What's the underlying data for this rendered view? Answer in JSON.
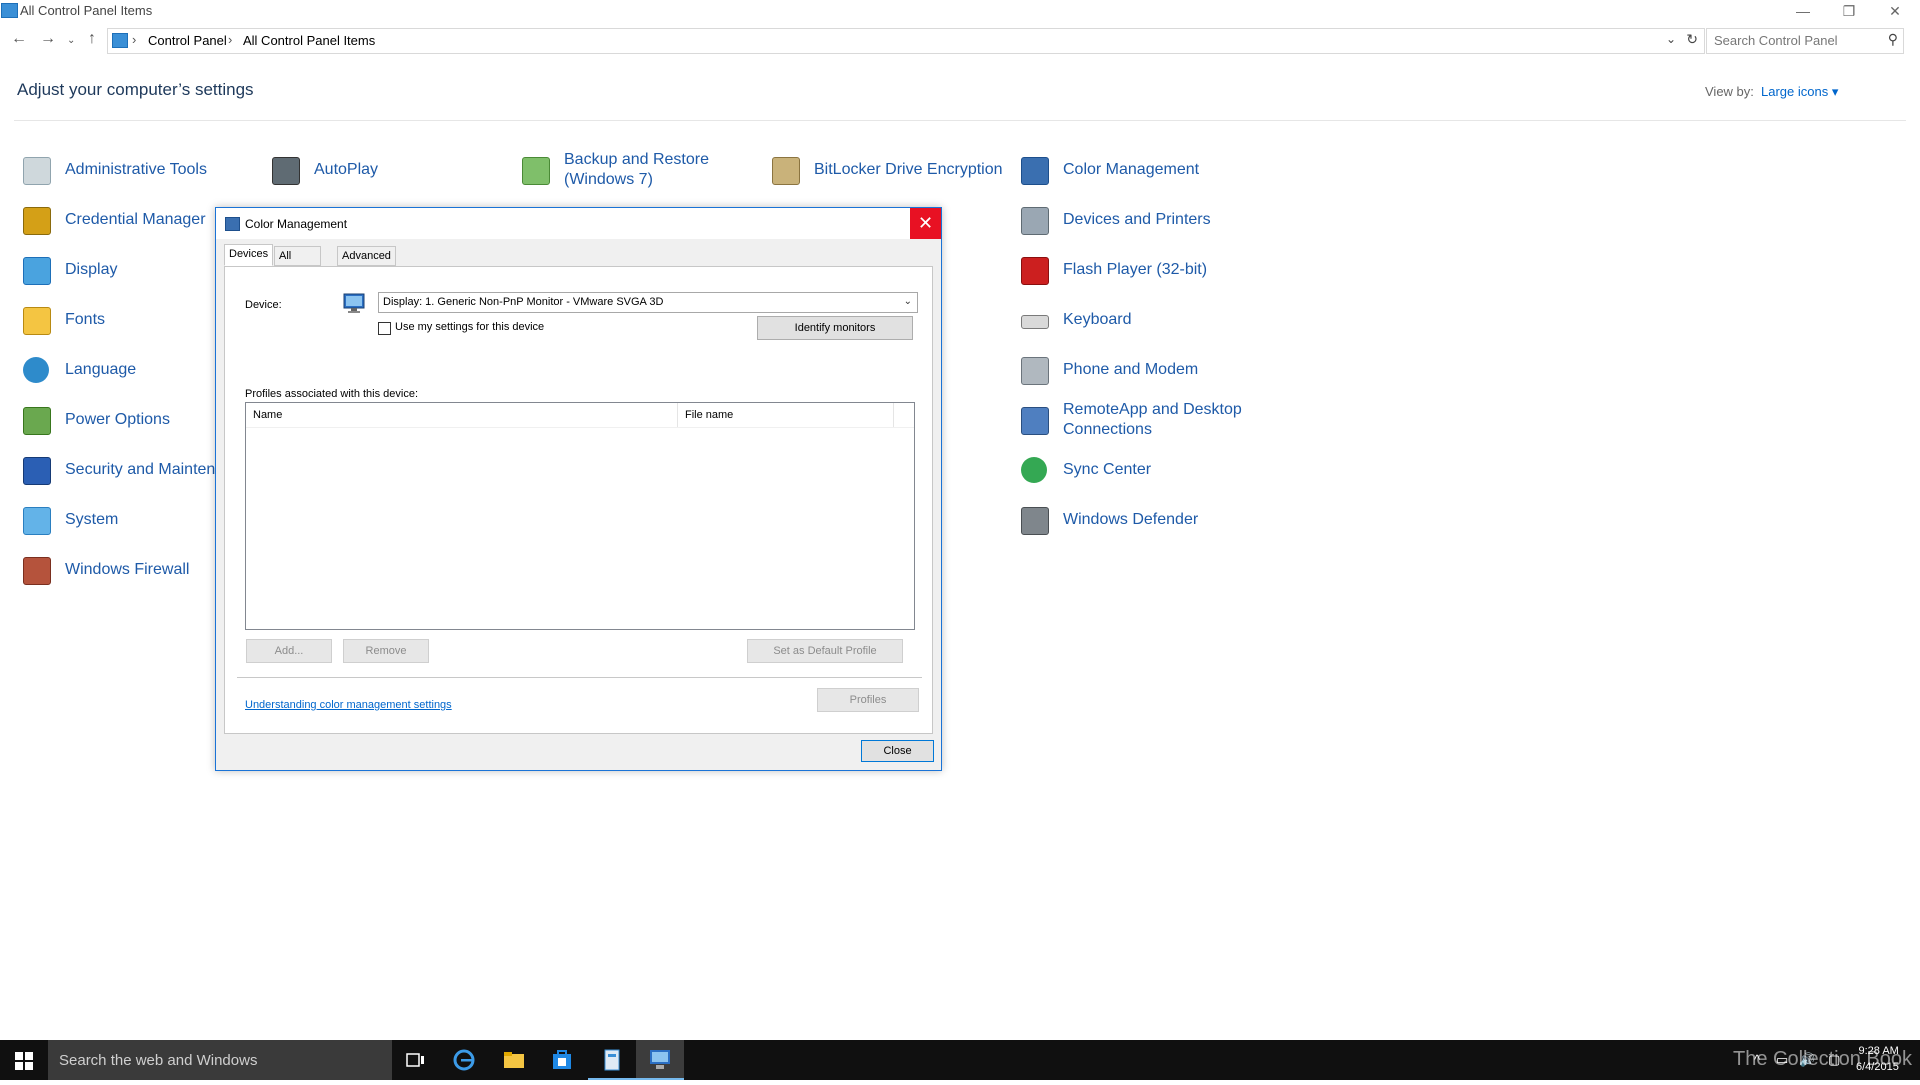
{
  "window": {
    "title": "All Control Panel Items",
    "minimize": "—",
    "maximize": "❐",
    "close": "✕"
  },
  "nav": {
    "back": "←",
    "forward": "→",
    "recent": "⌄",
    "up": "↑",
    "breadcrumb": [
      "Control Panel",
      "All Control Panel Items"
    ],
    "separator": "›",
    "dropdown": "⌄",
    "refresh": "↻",
    "search_placeholder": "Search Control Panel",
    "search_glyph": "⚲"
  },
  "header": {
    "heading": "Adjust your computer’s settings",
    "view_by_label": "View by:",
    "view_by_value": "Large icons ▾"
  },
  "items": {
    "col1": [
      "Administrative Tools",
      "Credential Manager",
      "Display",
      "Fonts",
      "Language",
      "Power Options",
      "Security and Maintenance",
      "System",
      "Windows Firewall"
    ],
    "autoplay": "AutoPlay",
    "backup": "Backup and Restore (Windows 7)",
    "bitlocker": "BitLocker Drive Encryption",
    "col5": [
      "Color Management",
      "Devices and Printers",
      "Flash Player (32-bit)",
      "Keyboard",
      "Phone and Modem",
      "RemoteApp and Desktop Connections",
      "Sync Center",
      "Windows Defender"
    ]
  },
  "colors": {
    "link": "#1e5aa8",
    "dialog_border": "#1a73d6",
    "close_red": "#e81123",
    "taskbar": "#101010"
  },
  "dialog": {
    "title": "Color Management",
    "close_glyph": "✕",
    "tabs": [
      "Devices",
      "All Profiles",
      "Advanced"
    ],
    "active_tab": "Devices",
    "device_label": "Device:",
    "device_value": "Display: 1. Generic Non-PnP Monitor - VMware SVGA 3D",
    "device_arrow": "⌄",
    "use_settings_label": "Use my settings for this device",
    "use_settings_checked": false,
    "identify_button": "Identify monitors",
    "profiles_label": "Profiles associated with this device:",
    "columns": [
      "Name",
      "File name"
    ],
    "rows": [],
    "add_button": "Add...",
    "remove_button": "Remove",
    "default_button": "Set as Default Profile",
    "help_link": "Understanding color management settings",
    "profiles_button": "Profiles",
    "close_button": "Close"
  },
  "taskbar": {
    "search_placeholder": "Search the web and Windows",
    "apps": [
      "task-view",
      "edge",
      "file-explorer",
      "store",
      "control-panel",
      "color-management"
    ],
    "tray": {
      "chevron": "^",
      "network": "▭",
      "volume": "🔊",
      "message": "▢"
    },
    "watermark": "The Collection Book",
    "time": "9:28 AM",
    "date": "6/4/2015"
  }
}
